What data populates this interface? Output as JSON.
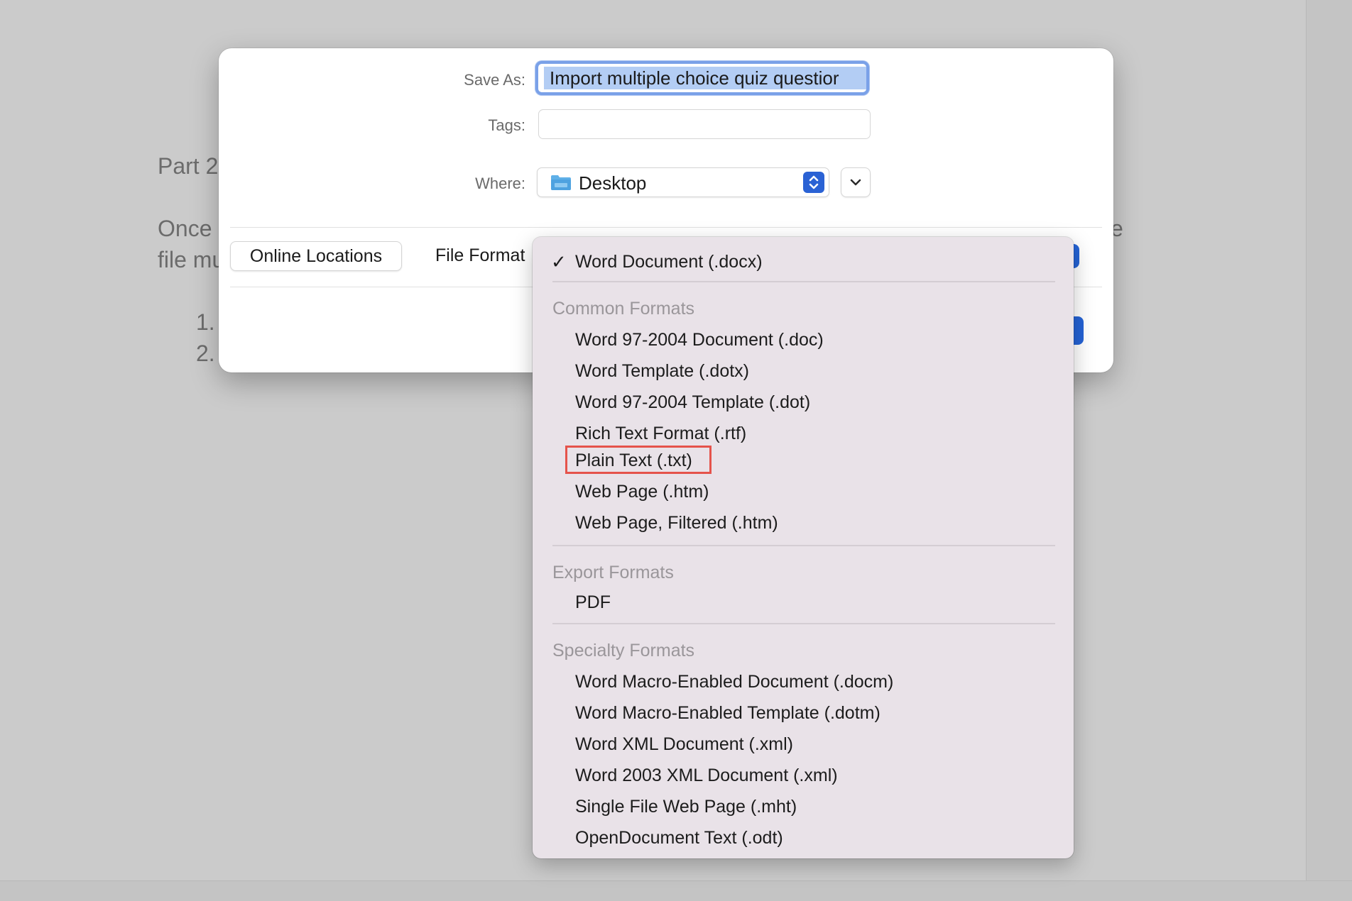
{
  "background_doc": {
    "heading": "Part 2",
    "line1_start": "Once",
    "line1_end": "e",
    "line2_start": "file mu",
    "list_item_1": "1.",
    "list_item_2": "2."
  },
  "dialog": {
    "save_as_label": "Save As:",
    "save_as_value": "Import multiple choice quiz questior",
    "tags_label": "Tags:",
    "tags_value": "",
    "where_label": "Where:",
    "where_value": "Desktop",
    "online_locations_label": "Online Locations",
    "file_format_label": "File Format"
  },
  "file_format_menu": {
    "selected": "Word Document (.docx)",
    "sections": [
      {
        "header": "Common Formats",
        "items": [
          "Word 97-2004 Document (.doc)",
          "Word Template (.dotx)",
          "Word 97-2004 Template (.dot)",
          "Rich Text Format (.rtf)",
          "Plain Text (.txt)",
          "Web Page (.htm)",
          "Web Page, Filtered (.htm)"
        ]
      },
      {
        "header": "Export Formats",
        "items": [
          "PDF"
        ]
      },
      {
        "header": "Specialty Formats",
        "items": [
          "Word Macro-Enabled Document (.docm)",
          "Word Macro-Enabled Template (.dotm)",
          "Word XML Document (.xml)",
          "Word 2003 XML Document (.xml)",
          "Single File Web Page (.mht)",
          "OpenDocument Text (.odt)"
        ]
      }
    ],
    "highlighted_item": "Plain Text (.txt)"
  },
  "colors": {
    "accent": "#2563d6",
    "highlight_box": "#e5534b",
    "menu_bg": "#e9e2e8"
  },
  "icons": {
    "folder": "folder-icon",
    "stepper": "chevron-updown-icon",
    "expand": "chevron-down-icon",
    "check": "checkmark-icon"
  }
}
